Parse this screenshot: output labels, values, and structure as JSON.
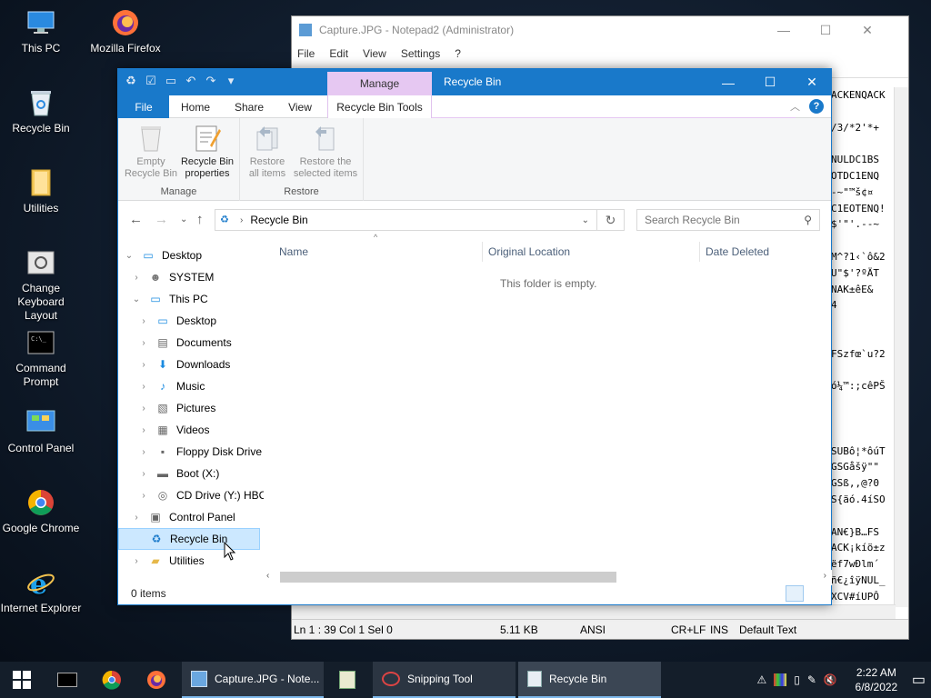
{
  "desktop": {
    "icons": [
      {
        "label": "This PC",
        "icon": "this-pc-icon"
      },
      {
        "label": "Mozilla Firefox",
        "icon": "firefox-icon"
      },
      {
        "label": "Recycle Bin",
        "icon": "recycle-bin-icon"
      },
      {
        "label": "Utilities",
        "icon": "folder-icon"
      },
      {
        "label": "Change Keyboard Layout",
        "label_l1": "Change",
        "label_l2": "Keyboard Layout",
        "icon": "keyboard-layout-icon"
      },
      {
        "label": "Command Prompt",
        "label_l1": "Command",
        "label_l2": "Prompt",
        "icon": "cmd-icon"
      },
      {
        "label": "Control Panel",
        "icon": "control-panel-icon"
      },
      {
        "label": "Google Chrome",
        "icon": "chrome-icon"
      },
      {
        "label": "Internet Explorer",
        "icon": "ie-icon"
      }
    ]
  },
  "notepad": {
    "title": "Capture.JPG - Notepad2 (Administrator)",
    "menu": [
      "File",
      "Edit",
      "View",
      "Settings",
      "?"
    ],
    "text_lines": [
      "ACKENQACK",
      "",
      "/3/*2'*+",
      "",
      "NULDC1BS",
      "OTDC1ENQ",
      "-~\"™š¢¤",
      "C1EOTENQ!",
      "$'\"'.--~",
      "",
      "M^?1‹`ô&2",
      "U\"$'?ºÄT",
      "NAK±êE&",
      "4",
      "",
      "",
      "FSzfœ`u?2",
      "",
      "ó¼™:;cêPŠ",
      "",
      "",
      "",
      "SUBô¦*ôúT",
      "GSGåšÿ\"\"",
      "GSß,,@?0",
      "S{äó.4íSO",
      "",
      "AN€}B…FS",
      "ACK¡kíö±z",
      "ëf7wĐlm´",
      "ñ€¿îÿNUL_",
      "XCV#íUPÔ"
    ],
    "status": {
      "position": "Ln 1 : 39   Col 1   Sel 0",
      "size": "5.11 KB",
      "encoding": "ANSI",
      "line_ending": "CR+LF",
      "mode": "INS",
      "scheme": "Default Text"
    }
  },
  "explorer": {
    "title": "Recycle Bin",
    "manage_tab": "Manage",
    "tabs": {
      "file": "File",
      "home": "Home",
      "share": "Share",
      "view": "View",
      "tools": "Recycle Bin Tools"
    },
    "ribbon": {
      "manage_group": "Manage",
      "restore_group": "Restore",
      "empty_l1": "Empty",
      "empty_l2": "Recycle Bin",
      "props_l1": "Recycle Bin",
      "props_l2": "properties",
      "restore_all_l1": "Restore",
      "restore_all_l2": "all items",
      "restore_sel_l1": "Restore the",
      "restore_sel_l2": "selected items"
    },
    "address": "Recycle Bin",
    "search_placeholder": "Search Recycle Bin",
    "nav": [
      {
        "label": "Desktop",
        "icon": "desktop-icon"
      },
      {
        "label": "SYSTEM",
        "icon": "user-icon"
      },
      {
        "label": "This PC",
        "icon": "this-pc-icon"
      },
      {
        "label": "Desktop",
        "icon": "desktop-icon"
      },
      {
        "label": "Documents",
        "icon": "documents-icon"
      },
      {
        "label": "Downloads",
        "icon": "downloads-icon"
      },
      {
        "label": "Music",
        "icon": "music-icon"
      },
      {
        "label": "Pictures",
        "icon": "pictures-icon"
      },
      {
        "label": "Videos",
        "icon": "videos-icon"
      },
      {
        "label": "Floppy Disk Drive",
        "icon": "floppy-icon"
      },
      {
        "label": "Boot (X:)",
        "icon": "drive-icon"
      },
      {
        "label": "CD Drive (Y:) HBC",
        "icon": "cd-drive-icon"
      },
      {
        "label": "Control Panel",
        "icon": "control-panel-icon"
      },
      {
        "label": "Recycle Bin",
        "icon": "recycle-bin-icon"
      },
      {
        "label": "Utilities",
        "icon": "folder-icon"
      }
    ],
    "columns": {
      "name": "Name",
      "location": "Original Location",
      "date": "Date Deleted"
    },
    "empty_message": "This folder is empty.",
    "status": "0 items"
  },
  "taskbar": {
    "tasks": [
      {
        "label": "Capture.JPG - Note...",
        "icon": "notepad2-icon"
      },
      {
        "label": "Snipping Tool",
        "icon": "snipping-tool-icon"
      },
      {
        "label": "Recycle Bin",
        "icon": "recycle-bin-icon"
      }
    ],
    "time": "2:22 AM",
    "date": "6/8/2022"
  },
  "colors": {
    "accent": "#1979ca",
    "manage": "#e6c8f2",
    "selection": "#cce8ff"
  }
}
